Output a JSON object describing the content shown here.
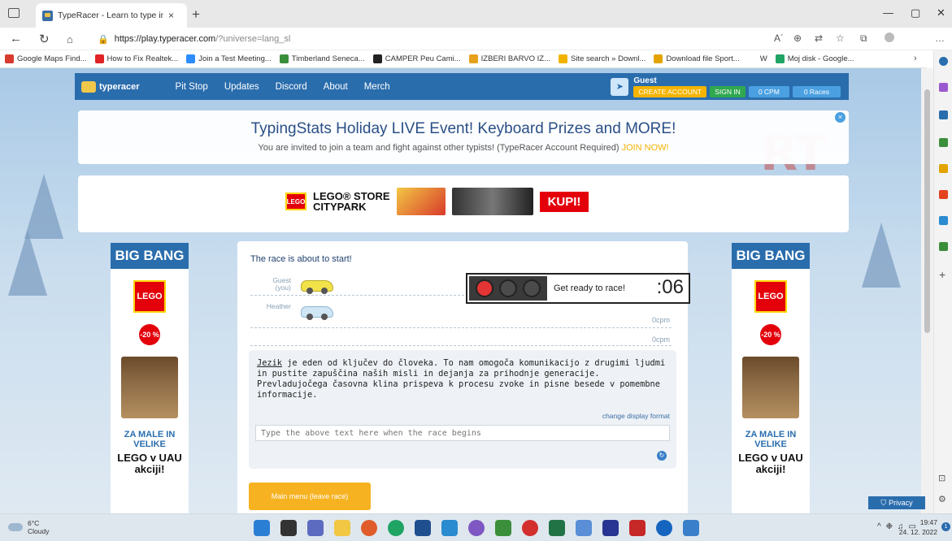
{
  "browser": {
    "tab_title": "TypeRacer - Learn to type in Slov",
    "tab_close": "×",
    "new_tab": "+",
    "url_host": "https://play.typeracer.com",
    "url_path": "/?universe=lang_sl",
    "read_aloud": "A´",
    "window": {
      "minimize": "—",
      "restore": "▢",
      "close": "✕"
    },
    "more": "…"
  },
  "bookmarks": [
    {
      "label": "Google Maps Find...",
      "color": "#d83b2e"
    },
    {
      "label": "How to Fix Realtek...",
      "color": "#e22323"
    },
    {
      "label": "Join a Test Meeting...",
      "color": "#2d8cff"
    },
    {
      "label": "Timberland Seneca...",
      "color": "#3b8f3b"
    },
    {
      "label": "CAMPER Peu Cami...",
      "color": "#222222"
    },
    {
      "label": "IZBERI BARVO IZ...",
      "color": "#e6a11c"
    },
    {
      "label": "Site search » Downl...",
      "color": "#f2b300"
    },
    {
      "label": "Download file Sport...",
      "color": "#e3a300"
    },
    {
      "label": "W",
      "color": "#ffffff"
    },
    {
      "label": "Moj disk - Google...",
      "color": "#1fa463"
    }
  ],
  "site": {
    "logo": "typeracer",
    "nav": [
      "Pit Stop",
      "Updates",
      "Discord",
      "About",
      "Merch"
    ],
    "user": {
      "name": "Guest",
      "create_account": "CREATE ACCOUNT",
      "sign_in": "SIGN IN",
      "wpm": "0 CPM",
      "races": "0 Races"
    },
    "bg_text": "RT"
  },
  "banner": {
    "title": "TypingStats Holiday LIVE Event! Keyboard Prizes and MORE!",
    "subtitle": "You are invited to join a team and fight against other typists! (TypeRacer Account Required)",
    "join": "JOIN NOW!",
    "close": "×"
  },
  "ad_top": {
    "brand": "LEGO",
    "store_line1": "LEGO® STORE",
    "store_line2": "CITYPARK",
    "cta": "KUPI!"
  },
  "side_ad": {
    "header": "BIG BANG",
    "brand": "LEGO",
    "discount": "-20 %",
    "line1": "ZA MALE IN VELIKE",
    "line2": "LEGO v UAU akciji!"
  },
  "race": {
    "title": "The race is about to start!",
    "lanes": [
      {
        "name": "Guest (you)",
        "color": "#f2e24a",
        "wpm": ""
      },
      {
        "name": "Heather",
        "color": "#cfe6f5",
        "wpm": "0cpm"
      },
      {
        "name": "",
        "color": "",
        "wpm": "0cpm"
      }
    ],
    "status": "Get ready to race!",
    "countdown": ":06",
    "text_first": "Jezik",
    "text_rest": " je eden od ključev do človeka. To nam omogoča komunikacijo z drugimi ljudmi in pustite zapuščina naših misli in dejanja za prihodnje generacije. Prevladujočega časovna klina prispeva k procesu zvoke in pisne besede v pomembne informacije.",
    "change_format": "change display format",
    "input_placeholder": "Type the above text here when the race begins",
    "main_menu": "Main menu (leave race)"
  },
  "privacy": "Privacy",
  "taskbar": {
    "temp": "6°C",
    "weather": "Cloudy",
    "time": "19:47",
    "date": "24. 12. 2022",
    "notifications": "1",
    "tray": [
      "^",
      "❉",
      "♫",
      "▭"
    ]
  }
}
